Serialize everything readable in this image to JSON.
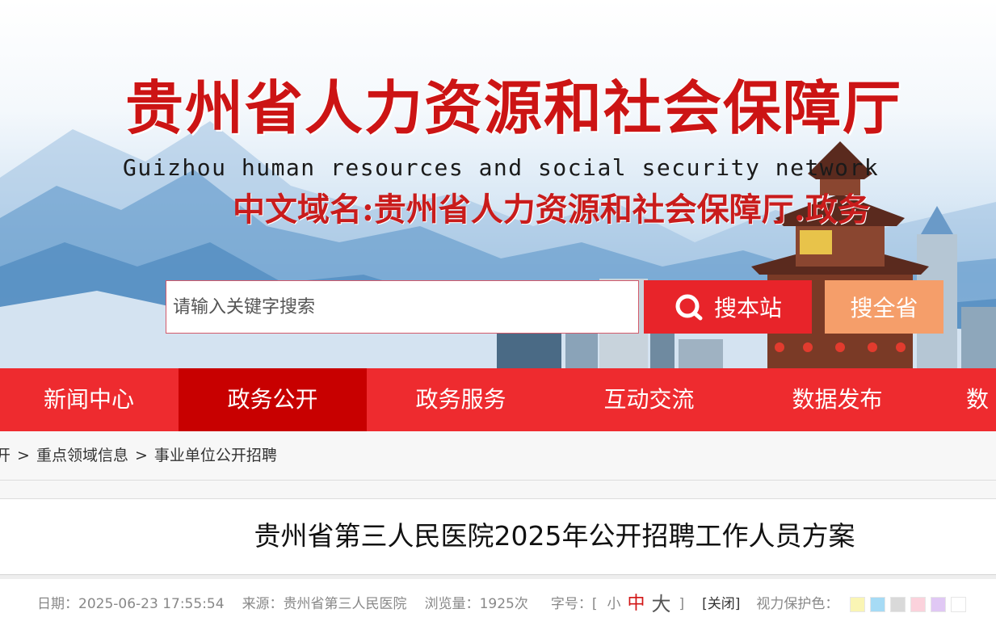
{
  "header": {
    "title": "贵州省人力资源和社会保障厅",
    "subtitle": "Guizhou human resources and social security network",
    "domain": "中文域名:贵州省人力资源和社会保障厅.政务"
  },
  "search": {
    "placeholder": "请输入关键字搜索",
    "site_label": "搜本站",
    "province_label": "搜全省"
  },
  "nav": {
    "items": [
      {
        "label": "新闻中心"
      },
      {
        "label": "政务公开"
      },
      {
        "label": "政务服务"
      },
      {
        "label": "互动交流"
      },
      {
        "label": "数据发布"
      },
      {
        "label": "数"
      }
    ],
    "active_index": 1
  },
  "breadcrumb": {
    "items": [
      "开",
      "重点领域信息",
      "事业单位公开招聘"
    ],
    "separator": ">"
  },
  "article": {
    "title": "贵州省第三人民医院2025年公开招聘工作人员方案",
    "date_label": "日期：",
    "date": "2025-06-23 17:55:54",
    "source_label": "来源：",
    "source": "贵州省第三人民医院",
    "views_label": "浏览量：",
    "views": "1925次",
    "font_label": "字号：",
    "bracket_open": "[",
    "bracket_close": "]",
    "font_small": "小",
    "font_medium": "中",
    "font_large": "大",
    "close_label": "[关闭]",
    "eye_care_label": "视力保护色："
  },
  "colors": {
    "nav_bg": "#ee2b2f",
    "nav_active": "#c80000",
    "search_btn": "#e8242a",
    "province_btn": "#f59e6a",
    "title_red": "#cc1414",
    "swatches": [
      "#faf5b4",
      "#a6dbf5",
      "#d9d9d9",
      "#fbd2dc",
      "#e0c8f4",
      "#ffffff"
    ]
  }
}
